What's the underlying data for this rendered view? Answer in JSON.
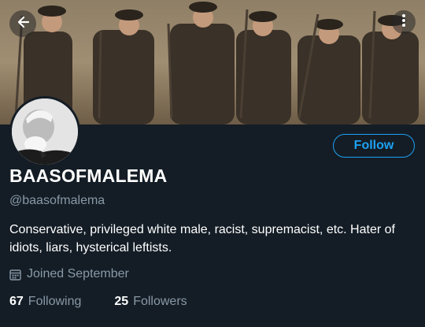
{
  "header": {
    "back_icon": "arrow-left-icon",
    "more_icon": "more-vertical-icon"
  },
  "profile": {
    "display_name": "BAASOFMALEMA",
    "handle": "@baasofmalema",
    "bio": "Conservative, privileged white male, racist, supremacist, etc.  Hater of idiots, liars, hysterical leftists.",
    "joined": "Joined September",
    "follow_label": "Follow"
  },
  "stats": {
    "following_count": "67",
    "following_label": "Following",
    "followers_count": "25",
    "followers_label": "Followers"
  },
  "colors": {
    "background": "#141d26",
    "accent": "#1da1f2",
    "secondary_text": "#8899a6"
  }
}
